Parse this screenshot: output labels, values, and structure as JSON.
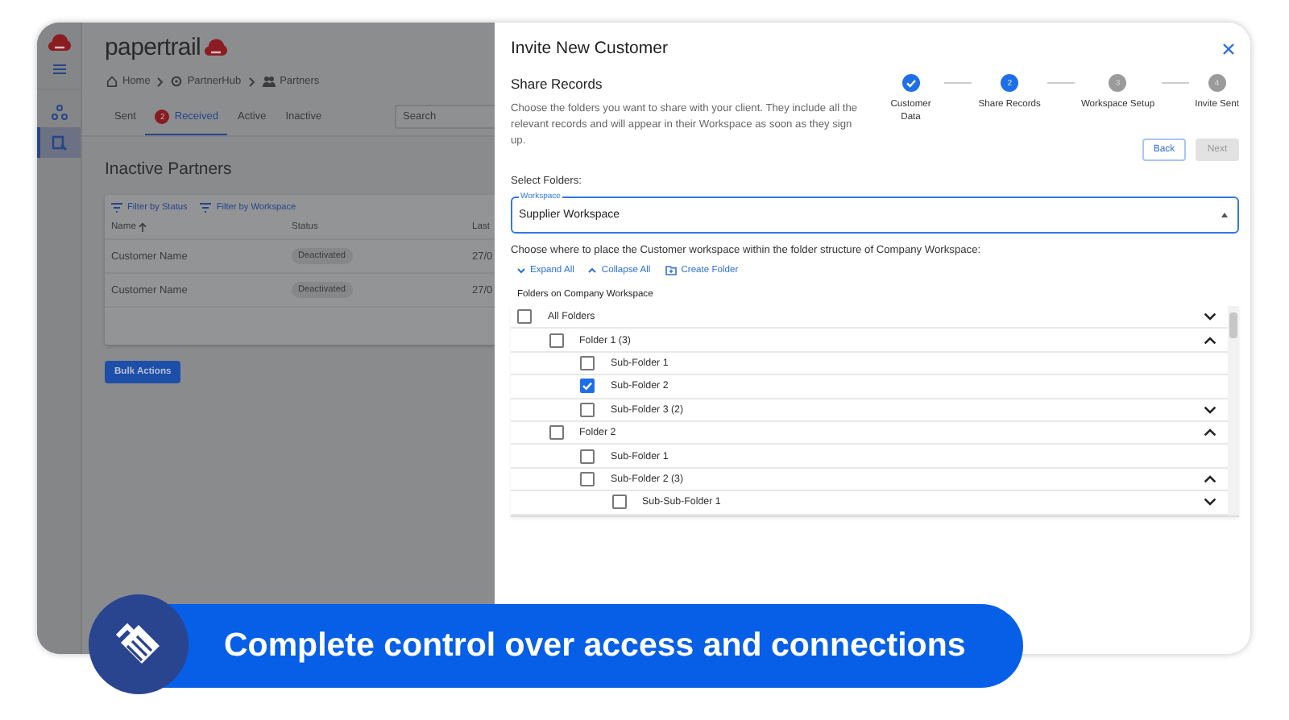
{
  "app": {
    "logo": "papertrail",
    "nav": [
      {
        "selected": false
      },
      {
        "selected": true
      }
    ],
    "breadcrumb": [
      {
        "label": "Home"
      },
      {
        "label": "PartnerHub"
      },
      {
        "label": "Partners"
      }
    ],
    "tabs": [
      {
        "label": "Sent",
        "selected": false
      },
      {
        "label": "Received",
        "selected": true,
        "badge": "2"
      },
      {
        "label": "Active",
        "selected": false
      },
      {
        "label": "Inactive",
        "selected": false
      }
    ],
    "search": {
      "placeholder": "Search"
    },
    "heading": "Inactive Partners",
    "filters": [
      "Filter by Status",
      "Filter by Workspace"
    ],
    "table": {
      "columns": [
        "Name",
        "Status",
        "Last"
      ],
      "rows": [
        {
          "name": "Customer Name",
          "status": "Deactivated",
          "date": "27/0"
        },
        {
          "name": "Customer Name",
          "status": "Deactivated",
          "date": "27/0"
        }
      ]
    },
    "bulk_button": "Bulk Actions"
  },
  "dialog": {
    "title": "Invite New Customer",
    "section_title": "Share Records",
    "description": "Choose the folders you want to share with your client. They include all the relevant records and will appear in their Workspace as soon as they sign up.",
    "steps": [
      {
        "label": "Customer Data",
        "completed": true
      },
      {
        "label": "Share Records",
        "completed": false,
        "active": true,
        "number": "2"
      },
      {
        "label": "Workspace Setup",
        "completed": false,
        "active": false,
        "number": "3"
      },
      {
        "label": "Invite Sent",
        "completed": false,
        "active": false,
        "number": "4"
      }
    ],
    "buttons": [
      {
        "label": "Back",
        "disabled": false
      },
      {
        "label": "Next",
        "disabled": true
      }
    ],
    "select_label": "Select Folders:",
    "workspace_field": {
      "label": "Workspace",
      "value": "Supplier Workspace"
    },
    "instruction": "Choose where to place the Customer workspace within the folder structure of Company Workspace:",
    "tree_actions": [
      {
        "label": "Expand All",
        "kind": "expand"
      },
      {
        "label": "Collapse All",
        "kind": "collapse"
      },
      {
        "label": "Create Folder",
        "kind": "create"
      }
    ],
    "tree_heading": "Folders on Company Workspace",
    "folders": [
      {
        "label": "All Folders",
        "checked": false,
        "expanded": false,
        "children": [
          {
            "label": "Folder 1 (3)",
            "checked": false,
            "expanded": true,
            "children": [
              {
                "label": "Sub-Folder 1",
                "checked": false
              },
              {
                "label": "Sub-Folder 2",
                "checked": true
              },
              {
                "label": "Sub-Folder 3 (2)",
                "checked": false,
                "expanded": false
              }
            ]
          },
          {
            "label": "Folder 2",
            "checked": false,
            "expanded": true,
            "children": [
              {
                "label": "Sub-Folder 1",
                "checked": false
              },
              {
                "label": "Sub-Folder 2 (3)",
                "checked": false,
                "expanded": true,
                "children": [
                  {
                    "label": "Sub-Sub-Folder 1",
                    "checked": false,
                    "expanded": false
                  }
                ]
              }
            ]
          }
        ]
      }
    ]
  },
  "banner": {
    "text": "Complete control over access and connections"
  }
}
